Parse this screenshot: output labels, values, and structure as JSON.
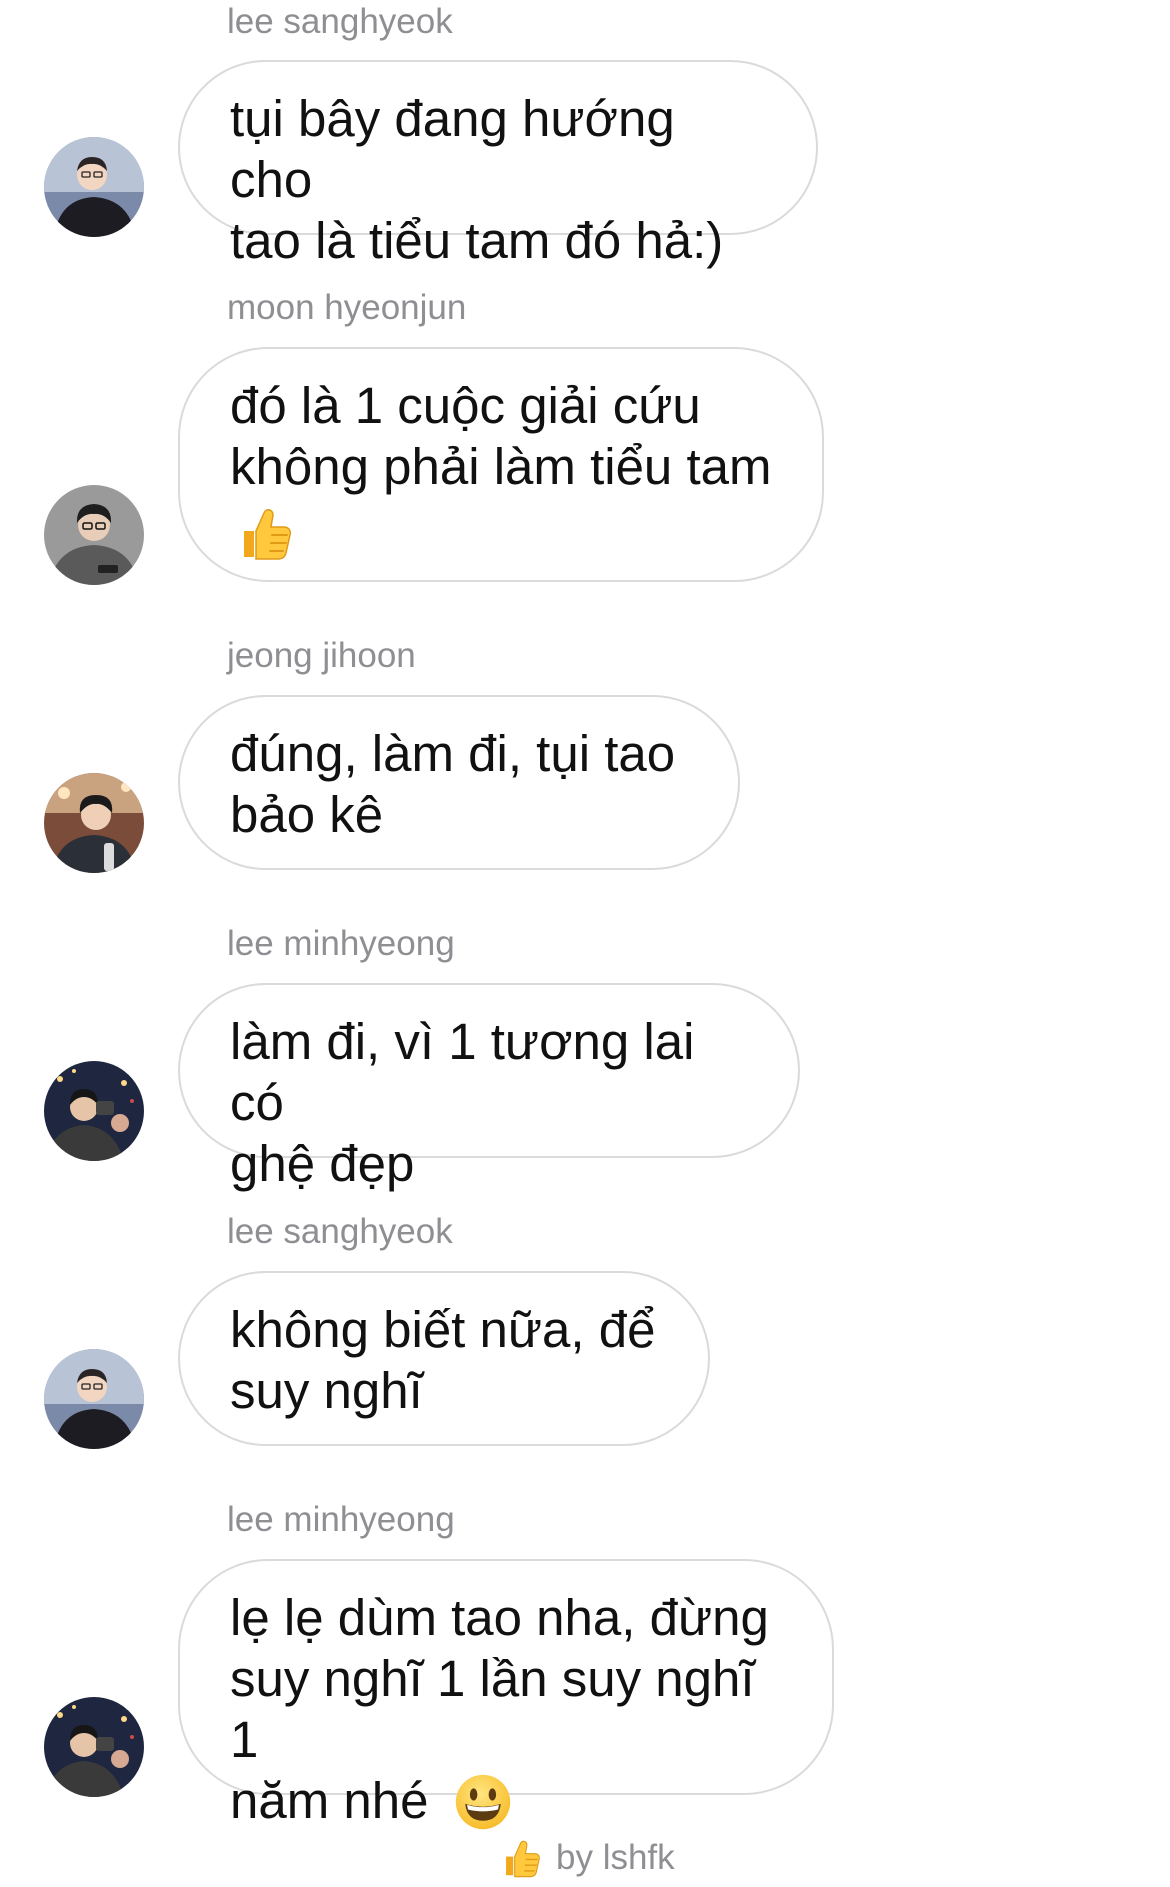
{
  "messages": [
    {
      "sender": "lee sanghyeok",
      "text": "tụi bây đang hướng cho\ntao là tiểu tam đó hả:)",
      "avatar_icon": "avatar-lee-sanghyeok"
    },
    {
      "sender": "moon hyeonjun",
      "text": "đó là 1 cuộc giải cứu\nkhông phải làm tiểu tam",
      "emoji": "thumbs-up",
      "avatar_icon": "avatar-moon-hyeonjun"
    },
    {
      "sender": "jeong jihoon",
      "text": "đúng, làm đi, tụi tao\nbảo kê",
      "avatar_icon": "avatar-jeong-jihoon"
    },
    {
      "sender": "lee minhyeong",
      "text": "làm đi, vì 1 tương lai có\nghệ đẹp",
      "avatar_icon": "avatar-lee-minhyeong"
    },
    {
      "sender": "lee sanghyeok",
      "text": "không biết nữa, để\nsuy nghĩ",
      "avatar_icon": "avatar-lee-sanghyeok"
    },
    {
      "sender": "lee minhyeong",
      "text": "lẹ lẹ dùm tao nha, đừng\nsuy nghĩ 1 lần suy nghĩ 1\nnăm nhé",
      "emoji": "grinning-face",
      "avatar_icon": "avatar-lee-minhyeong"
    }
  ],
  "footer": {
    "icon": "thumbs-up",
    "text": "by lshfk"
  },
  "colors": {
    "sender_text": "#8e8e93",
    "bubble_border": "#dadada",
    "message_text": "#111111",
    "background": "#ffffff"
  }
}
